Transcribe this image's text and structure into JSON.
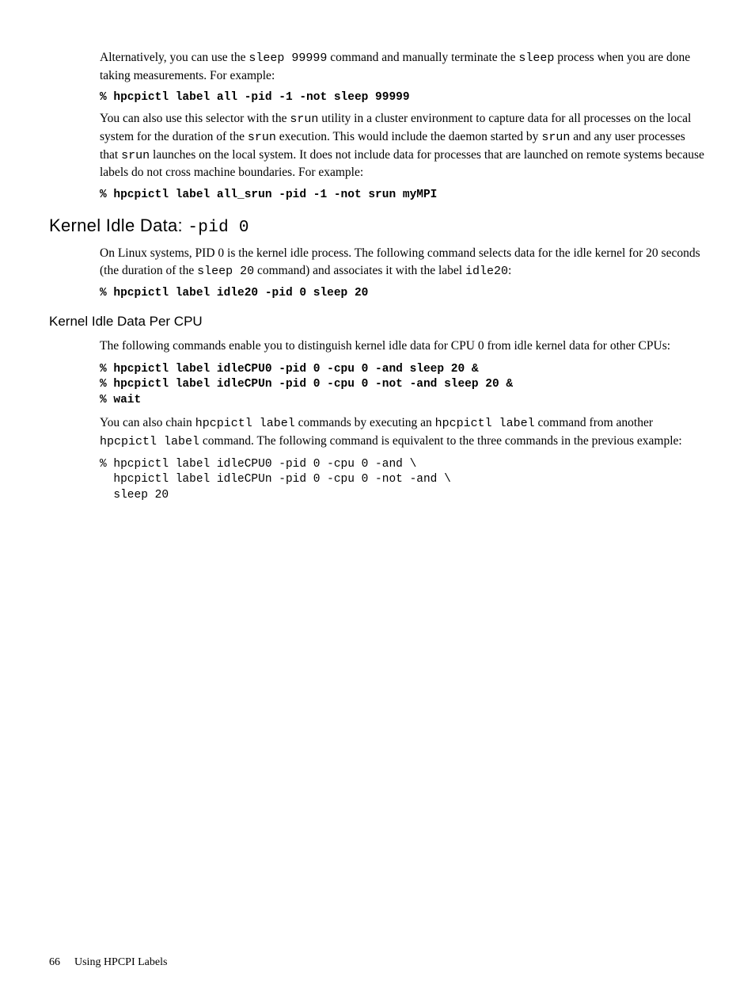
{
  "para1_a": "Alternatively, you can use the ",
  "para1_c1": "sleep 99999",
  "para1_b": " command and manually terminate the ",
  "para1_c2": "sleep",
  "para1_c": " process when you are done taking measurements. For example:",
  "code1": "% hpcpictl label all -pid -1 -not sleep 99999",
  "para2_a": "You can also use this selector with the ",
  "para2_c1": "srun",
  "para2_b": " utility in a cluster environment to capture data for all processes on the local system for the duration of the ",
  "para2_c2": "srun",
  "para2_c": " execution. This would include the daemon started by ",
  "para2_c3": "srun",
  "para2_d": " and any user processes that ",
  "para2_c4": "srun",
  "para2_e": " launches on the local system. It does not include data for processes that are launched on remote systems because labels do not cross machine boundaries. For example:",
  "code2": "% hpcpictl label all_srun -pid -1 -not srun myMPI",
  "h2_a": "Kernel Idle Data: ",
  "h2_b": "-pid 0",
  "para3_a": "On Linux systems, PID 0 is the kernel idle process. The following command selects data for the idle kernel for 20 seconds (the duration of the ",
  "para3_c1": "sleep 20",
  "para3_b": " command) and associates it with the label ",
  "para3_c2": "idle20",
  "para3_c": ":",
  "code3": "% hpcpictl label idle20 -pid 0 sleep 20",
  "h3": "Kernel Idle Data Per CPU",
  "para4": "The following commands enable you to distinguish kernel idle data for CPU 0 from idle kernel data for other CPUs:",
  "code4": "% hpcpictl label idleCPU0 -pid 0 -cpu 0 -and sleep 20 &\n% hpcpictl label idleCPUn -pid 0 -cpu 0 -not -and sleep 20 &\n% wait",
  "para5_a": "You can also chain ",
  "para5_c1": "hpcpictl label",
  "para5_b": " commands by executing an ",
  "para5_c2": "hpcpictl label",
  "para5_c": " command from another ",
  "para5_c3": "hpcpictl label",
  "para5_d": " command. The following command is equivalent to the three commands in the previous example:",
  "code5": "% hpcpictl label idleCPU0 -pid 0 -cpu 0 -and \\\n  hpcpictl label idleCPUn -pid 0 -cpu 0 -not -and \\\n  sleep 20",
  "footer_page": "66",
  "footer_text": "Using HPCPI Labels"
}
